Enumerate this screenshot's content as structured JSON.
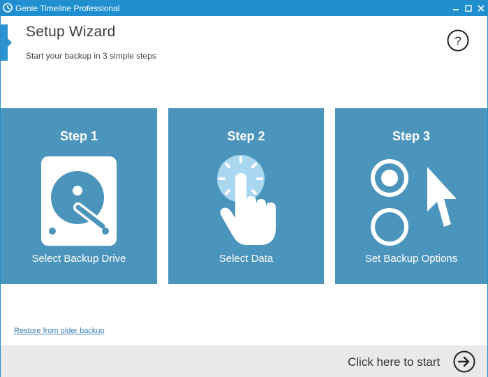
{
  "window": {
    "title": "Genie Timeline Professional",
    "accent_color": "#1f8fd0"
  },
  "header": {
    "title": "Setup Wizard",
    "subtitle": "Start your backup in 3 simple steps",
    "help_glyph": "?"
  },
  "steps": [
    {
      "title": "Step 1",
      "caption": "Select Backup Drive",
      "icon": "hard-drive-icon"
    },
    {
      "title": "Step 2",
      "caption": "Select Data",
      "icon": "tap-hand-icon"
    },
    {
      "title": "Step 3",
      "caption": "Set Backup Options",
      "icon": "options-cursor-icon"
    }
  ],
  "tile_color": "#4b94bb",
  "links": {
    "restore": "Restore from older backup"
  },
  "footer": {
    "start_label": "Click here to start"
  }
}
